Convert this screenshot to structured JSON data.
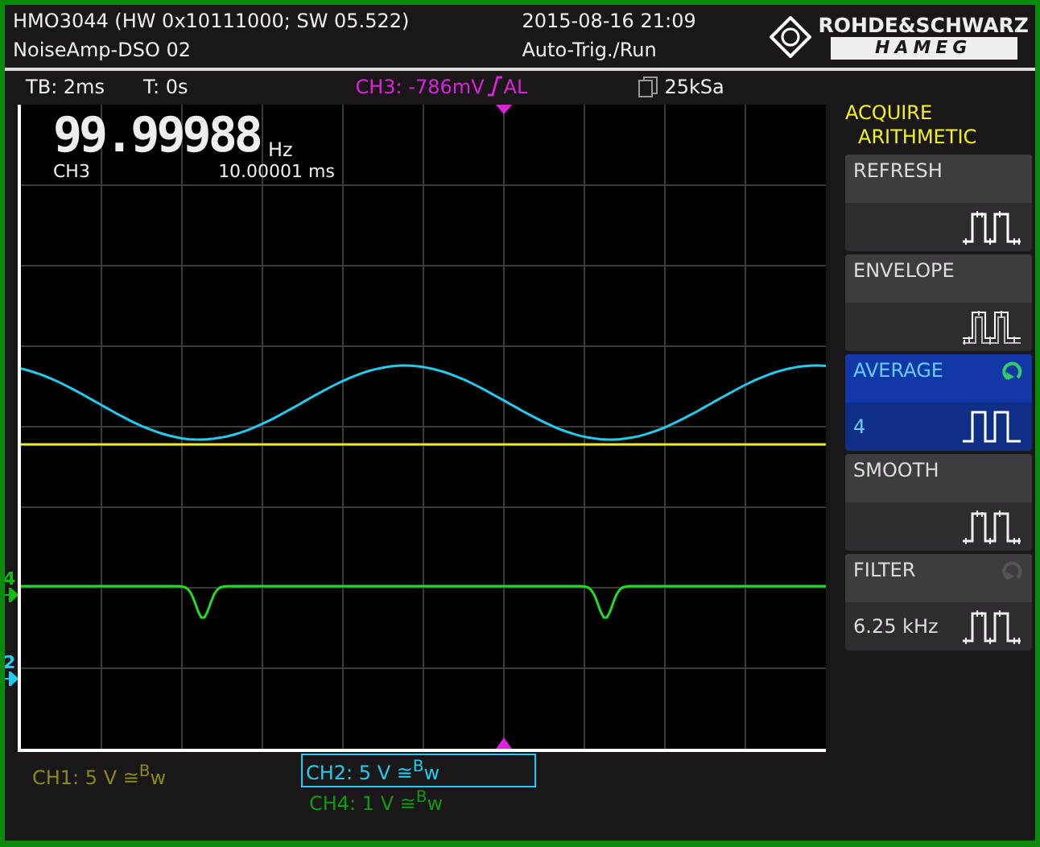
{
  "header": {
    "model": "HMO3044 (HW 0x10111000; SW 05.522)",
    "name": "NoiseAmp-DSO 02",
    "datetime": "2015-08-16 21:09",
    "mode": "Auto-Trig./Run",
    "brand": "ROHDE&SCHWARZ",
    "sub_brand": "HAMEG"
  },
  "status": {
    "timebase": "TB: 2ms",
    "time_offset": "T: 0s",
    "trigger": "CH3: -786mV",
    "trigger_source": "AL",
    "sample_rate": "25kSa"
  },
  "counter": {
    "value": "99.99988",
    "unit": "Hz",
    "channel": "CH3",
    "period": "10.00001 ms"
  },
  "markers": [
    {
      "label": "4",
      "color": "#11bb11"
    },
    {
      "label": "2",
      "color": "#22ccee"
    }
  ],
  "menu": {
    "title": "ACQUIRE",
    "subtitle": "ARITHMETIC",
    "items": [
      {
        "label": "REFRESH",
        "kind": "noisy",
        "selected": false
      },
      {
        "label": "ENVELOPE",
        "kind": "envelope",
        "selected": false
      },
      {
        "label": "AVERAGE",
        "kind": "clean",
        "selected": true,
        "value": "4",
        "reset_active": true
      },
      {
        "label": "SMOOTH",
        "kind": "smooth",
        "selected": false
      },
      {
        "label": "FILTER",
        "kind": "smooth",
        "selected": false,
        "value": "6.25 kHz",
        "reset_active": false
      }
    ]
  },
  "channels": [
    {
      "label": "CH1: 5 V ≅$^{B}$w",
      "color": "#8a8a1a",
      "selected": false
    },
    {
      "label": "CH2: 5 V ≅$^{B}$w",
      "color": "#22ccee",
      "selected": true
    },
    {
      "label": "CH4: 1 V ≅$^{B}$w",
      "color": "#119911",
      "selected": false
    }
  ]
}
